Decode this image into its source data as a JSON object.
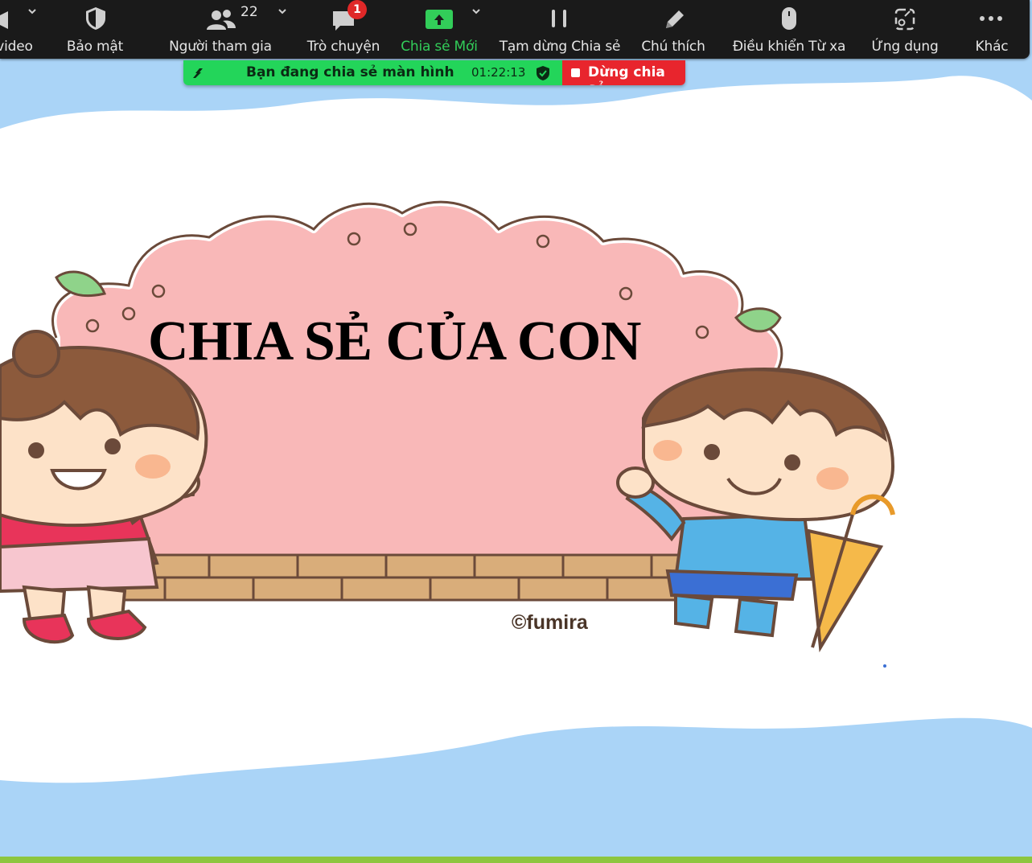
{
  "toolbar": {
    "items": [
      {
        "label": "video",
        "icon": "camera-icon"
      },
      {
        "label": "Bảo mật",
        "icon": "shield-icon"
      },
      {
        "label": "Người tham gia",
        "icon": "participants-icon",
        "count": "22"
      },
      {
        "label": "Trò chuyện",
        "icon": "chat-icon",
        "badge": "1"
      },
      {
        "label": "Chia sẻ Mới",
        "icon": "share-screen-icon"
      },
      {
        "label": "Tạm dừng Chia sẻ",
        "icon": "pause-icon"
      },
      {
        "label": "Chú thích",
        "icon": "pencil-icon"
      },
      {
        "label": "Điều khiển Từ xa",
        "icon": "mouse-icon"
      },
      {
        "label": "Ứng dụng",
        "icon": "apps-icon"
      },
      {
        "label": "Khác",
        "icon": "more-icon"
      }
    ],
    "active_color": "#32cd59"
  },
  "share_banner": {
    "status": "Bạn đang chia sẻ màn hình",
    "timer": "01:22:13",
    "stop_label": "Dừng chia sẻ",
    "green": "#23d55a",
    "red": "#e8252d"
  },
  "slide": {
    "headline": "CHIA SẺ CỦA CON",
    "copyright": "©fumira",
    "sky_color": "#aad4f7",
    "sign_color": "#f9b8b8"
  }
}
